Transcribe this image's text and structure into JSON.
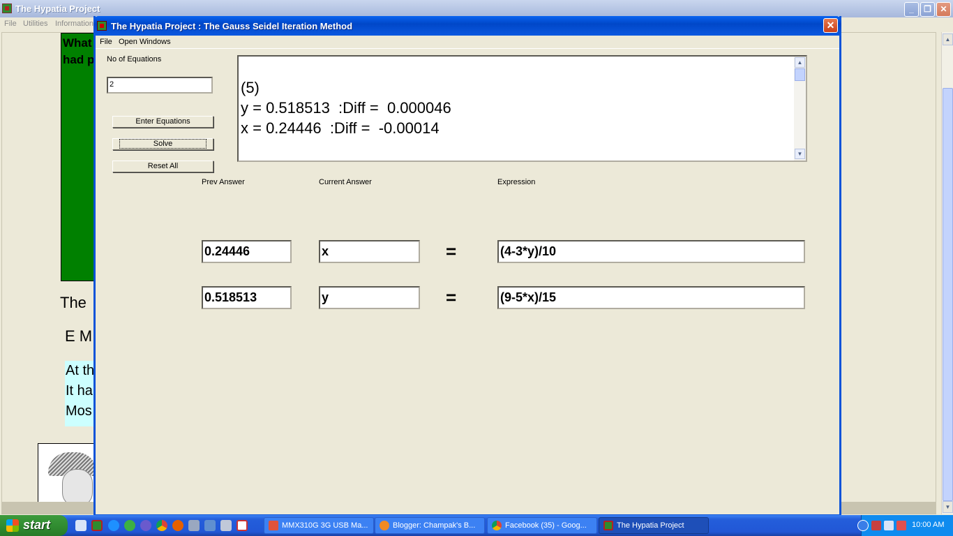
{
  "main_window": {
    "title": "The Hypatia Project",
    "menu": [
      "File",
      "Utilities",
      "Information"
    ],
    "controls": {
      "minimize": "_",
      "restore": "❐",
      "close": "✕"
    },
    "background_text": {
      "green_line1": "What",
      "green_line2": "had p",
      "line_the": "The",
      "line_em": "E M",
      "cyan_lines": [
        "At th",
        "It ha",
        "Mos"
      ]
    }
  },
  "dialog": {
    "title": "The Hypatia Project : The Gauss Seidel Iteration Method",
    "close": "✕",
    "menu": [
      "File",
      "Open Windows"
    ],
    "num_eq_label": "No of Equations",
    "num_eq_value": "2",
    "buttons": {
      "enter": "Enter Equations",
      "solve": "Solve",
      "reset": "Reset All"
    },
    "output_lines": [
      "(5)",
      "y = 0.518513  :Diff =  0.000046",
      "x = 0.24446  :Diff =  -0.00014"
    ],
    "headers": {
      "prev": "Prev Answer",
      "current": "Current Answer",
      "expr": "Expression"
    },
    "equations": [
      {
        "prev": "0.24446",
        "var": "x",
        "sign": "=",
        "expr": "(4-3*y)/10"
      },
      {
        "prev": "0.518513",
        "var": "y",
        "sign": "=",
        "expr": "(9-5*x)/15"
      }
    ]
  },
  "taskbar": {
    "start": "start",
    "tasks": [
      {
        "label": "MMX310G 3G USB Ma...",
        "color": "#e0533a"
      },
      {
        "label": "Blogger: Champak's B...",
        "color": "#f08a24"
      },
      {
        "label": "Facebook (35) - Goog...",
        "color": "#f4c430"
      },
      {
        "label": "The Hypatia Project",
        "color": "#2e8b2e"
      }
    ],
    "clock": "10:00 AM"
  }
}
